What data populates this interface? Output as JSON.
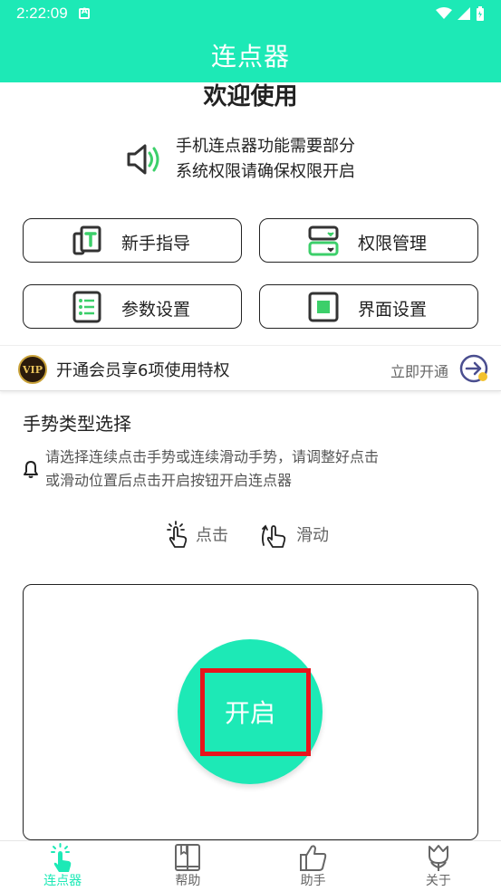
{
  "status_bar": {
    "time": "2:22:09"
  },
  "app_bar": {
    "title": "连点器"
  },
  "welcome": "欢迎使用",
  "notice": {
    "line1": "手机连点器功能需要部分",
    "line2": "系统权限请确保权限开启"
  },
  "buttons": {
    "guide": "新手指导",
    "permission": "权限管理",
    "params": "参数设置",
    "interface": "界面设置"
  },
  "vip": {
    "badge": "VIP",
    "text": "开通会员享6项使用特权",
    "action": "立即开通"
  },
  "gesture_section": {
    "title": "手势类型选择",
    "hint": "请选择连续点击手势或连续滑动手势，请调整好点击或滑动位置后点击开启按钮开启连点器",
    "click_label": "点击",
    "slide_label": "滑动"
  },
  "start_button": {
    "label": "开启"
  },
  "tabs": [
    {
      "label": "连点器",
      "active": true
    },
    {
      "label": "帮助",
      "active": false
    },
    {
      "label": "助手",
      "active": false
    },
    {
      "label": "关于",
      "active": false
    }
  ],
  "colors": {
    "accent": "#1de9b6",
    "green_icon": "#3ccf6a",
    "highlight": "#e8141c"
  }
}
